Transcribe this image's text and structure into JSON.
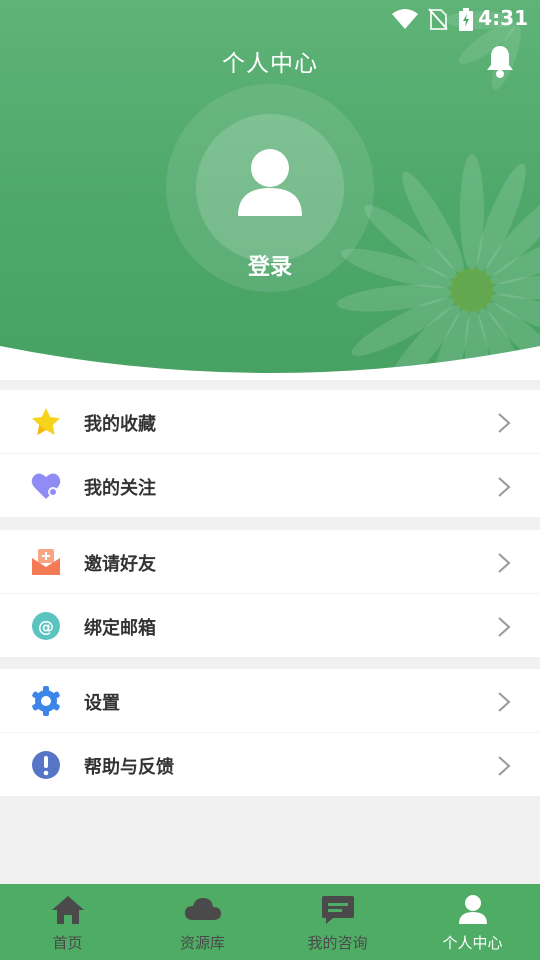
{
  "status_bar": {
    "time": "4:31"
  },
  "header": {
    "title": "个人中心",
    "login_label": "登录"
  },
  "menu_groups": [
    {
      "items": [
        {
          "label": "我的收藏",
          "icon": "star-icon"
        },
        {
          "label": "我的关注",
          "icon": "heart-icon"
        }
      ]
    },
    {
      "items": [
        {
          "label": "邀请好友",
          "icon": "envelope-icon"
        },
        {
          "label": "绑定邮箱",
          "icon": "at-icon"
        }
      ]
    },
    {
      "items": [
        {
          "label": "设置",
          "icon": "gear-icon"
        },
        {
          "label": "帮助与反馈",
          "icon": "exclamation-icon"
        }
      ]
    }
  ],
  "tabbar": {
    "tabs": [
      {
        "label": "首页",
        "icon": "home-icon"
      },
      {
        "label": "资源库",
        "icon": "cloud-icon"
      },
      {
        "label": "我的咨询",
        "icon": "chat-icon"
      },
      {
        "label": "个人中心",
        "icon": "person-icon"
      }
    ],
    "active_index": 3
  },
  "colors": {
    "header_green": "#4ea86a",
    "tabbar_green": "#4eac64",
    "star_yellow": "#f7d31a",
    "heart_purple": "#8f8cf5",
    "envelope_orange": "#f47a55",
    "at_teal": "#5cc4c0",
    "gear_blue": "#3b86e8",
    "help_indigo": "#5775c6"
  }
}
